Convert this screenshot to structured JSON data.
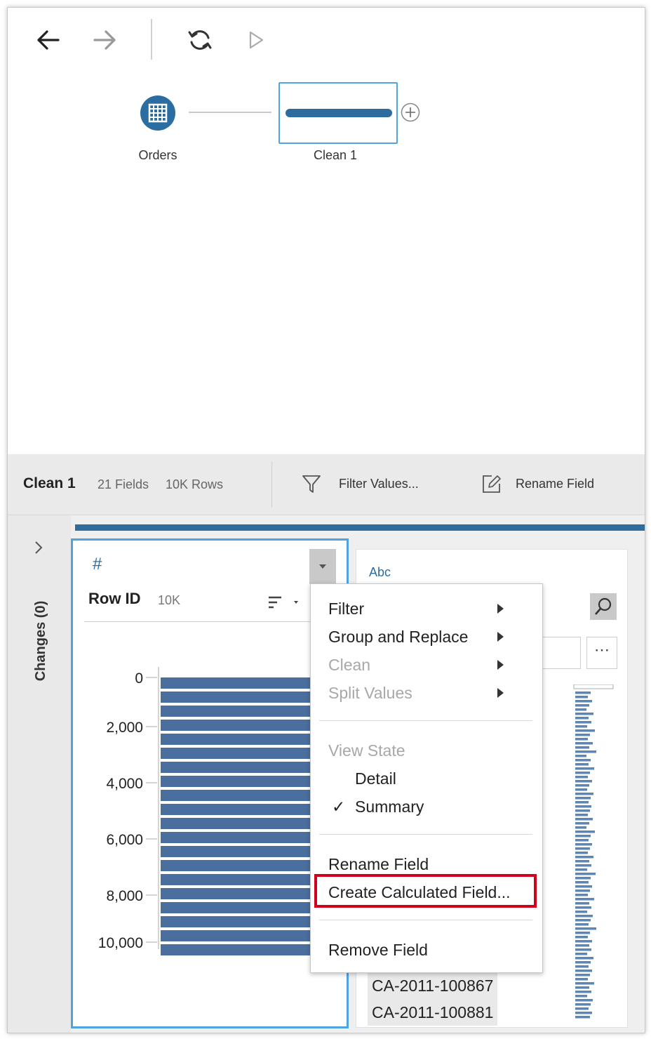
{
  "toolbar": {
    "back_icon": "arrow-left-icon",
    "forward_icon": "arrow-right-icon",
    "refresh_icon": "refresh-icon",
    "run_icon": "play-icon"
  },
  "flow": {
    "nodes": [
      {
        "label": "Orders",
        "icon": "table-icon"
      },
      {
        "label": "Clean 1",
        "icon": "clean-step-icon"
      }
    ],
    "add_icon": "plus-circle-icon"
  },
  "profile_header": {
    "step_name": "Clean 1",
    "fields": "21 Fields",
    "rows": "10K Rows",
    "filter_label": "Filter Values...",
    "rename_label": "Rename Field"
  },
  "changes_panel": {
    "label": "Changes (0)"
  },
  "field_card": {
    "type_icon": "#",
    "name": "Row ID",
    "count": "10K",
    "ticks": [
      "0",
      "2,000",
      "4,000",
      "6,000",
      "8,000",
      "10,000"
    ],
    "bar_color": "#4a6f9f"
  },
  "field_card2": {
    "type_label": "Abc",
    "values": [
      "CA-2011-100867",
      "CA-2011-100881"
    ]
  },
  "context_menu": {
    "items": [
      {
        "label": "Filter",
        "submenu": true,
        "disabled": false
      },
      {
        "label": "Group and Replace",
        "submenu": true,
        "disabled": false
      },
      {
        "label": "Clean",
        "submenu": true,
        "disabled": true
      },
      {
        "label": "Split Values",
        "submenu": true,
        "disabled": true
      }
    ],
    "view_state_label": "View State",
    "view_detail": "Detail",
    "view_summary": "Summary",
    "check_mark": "✓",
    "rename": "Rename Field",
    "create_calc": "Create Calculated Field...",
    "remove": "Remove Field"
  },
  "colors": {
    "accent": "#2e6c9e",
    "highlight": "#d0021b"
  }
}
